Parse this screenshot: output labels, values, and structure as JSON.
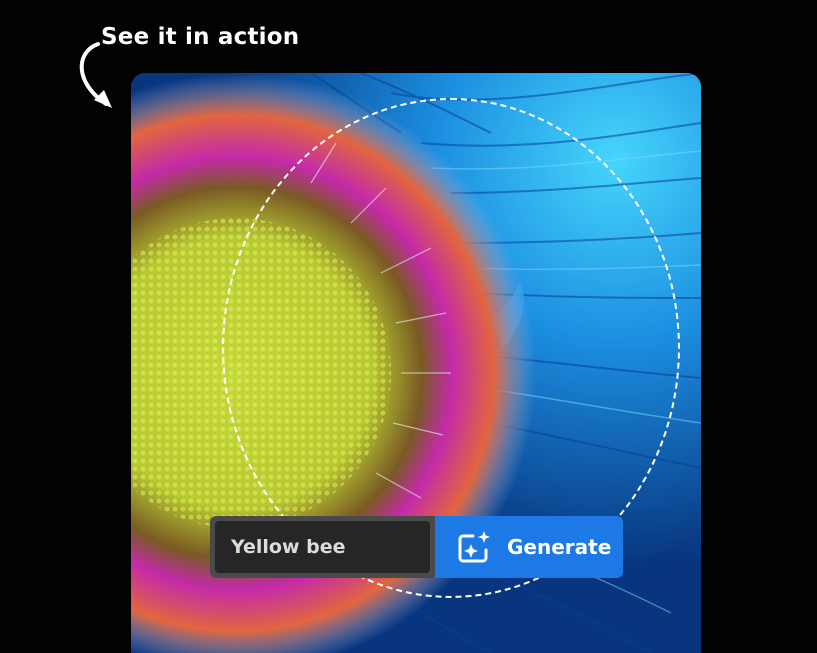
{
  "heading": {
    "text": "See it in action"
  },
  "prompt": {
    "value": "Yellow bee"
  },
  "generate_button": {
    "label": "Generate",
    "icon": "magic-sparkle-icon"
  },
  "colors": {
    "background": "#020202",
    "button_blue": "#1c79e6",
    "input_dark": "#262626",
    "prompt_bar": "#4a4a4a",
    "petal_blue": "#1b86dc"
  },
  "image": {
    "subject": "flower-photo",
    "icon": "flower-image"
  }
}
